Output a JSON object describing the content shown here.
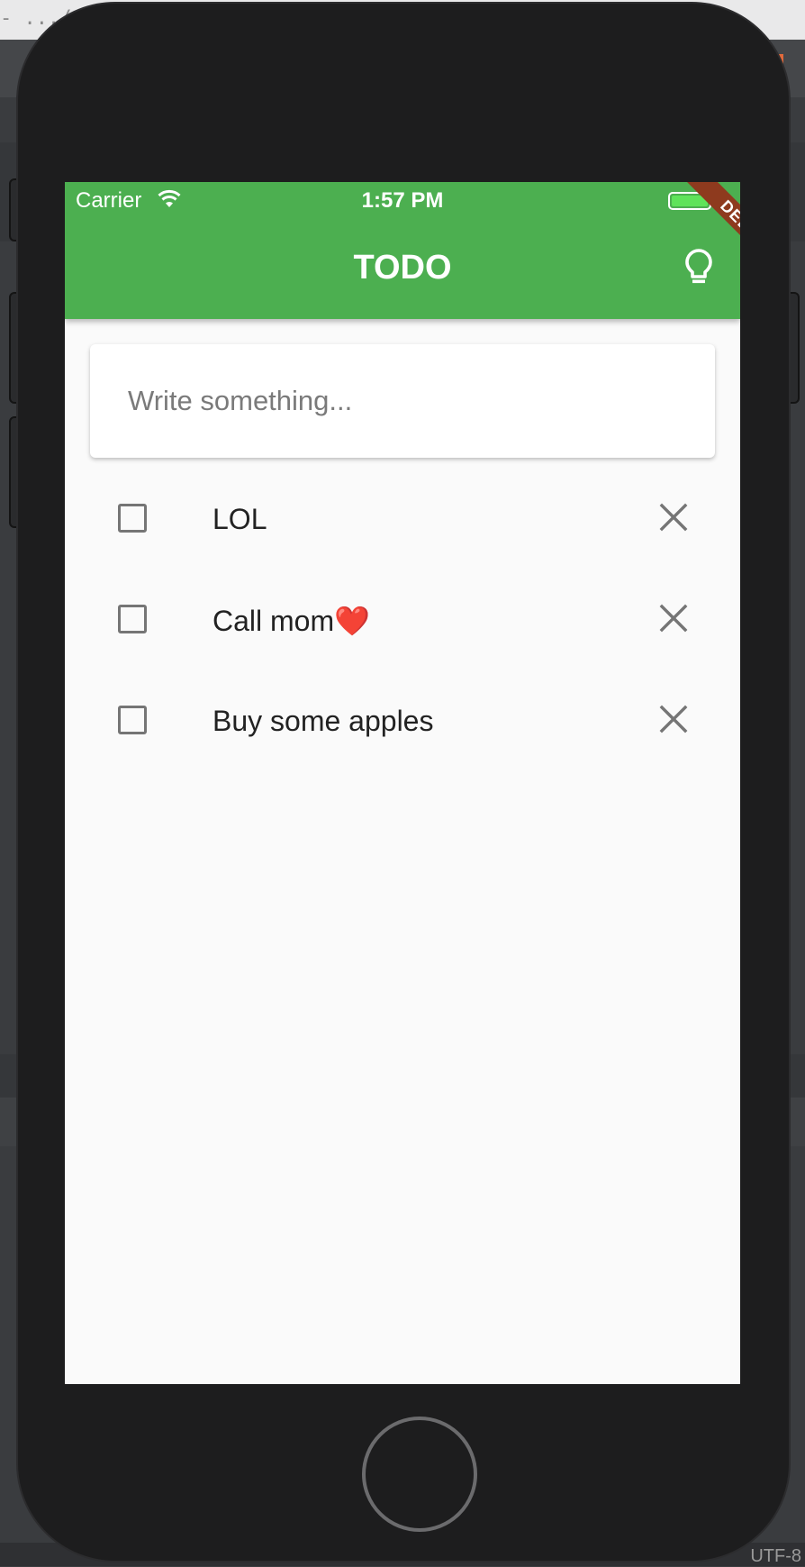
{
  "window": {
    "path_fragment": "- .../",
    "encoding": "UTF-8"
  },
  "status_bar": {
    "carrier": "Carrier",
    "time": "1:57 PM",
    "wifi_icon": "wifi-icon",
    "battery_icon": "battery-charging-icon"
  },
  "app_bar": {
    "title": "TODO",
    "action_icon": "lightbulb-outline-icon",
    "background": "#4caf50",
    "debug_label": "DEBUG"
  },
  "input": {
    "placeholder": "Write something...",
    "value": ""
  },
  "todos": [
    {
      "label": "LOL",
      "checked": false,
      "delete_icon": "close-icon"
    },
    {
      "label": "Call mom❤️",
      "checked": false,
      "delete_icon": "close-icon"
    },
    {
      "label": "Buy some apples",
      "checked": false,
      "delete_icon": "close-icon"
    }
  ]
}
